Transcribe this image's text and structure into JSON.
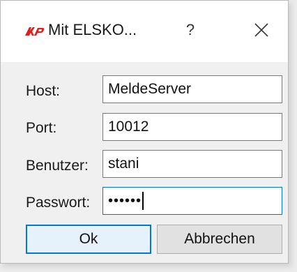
{
  "window": {
    "title": "Mit ELSKO...",
    "help_label": "?",
    "logo_icon": "elsko-logo",
    "logo_color": "#e01e1e"
  },
  "form": {
    "host": {
      "label": "Host:",
      "value": "MeldeServer"
    },
    "port": {
      "label": "Port:",
      "value": "10012"
    },
    "user": {
      "label": "Benutzer:",
      "value": "stani"
    },
    "password": {
      "label": "Passwort:",
      "value": "••••••"
    }
  },
  "buttons": {
    "ok_label": "Ok",
    "cancel_label": "Abbrechen"
  },
  "colors": {
    "focus": "#0078d7"
  }
}
